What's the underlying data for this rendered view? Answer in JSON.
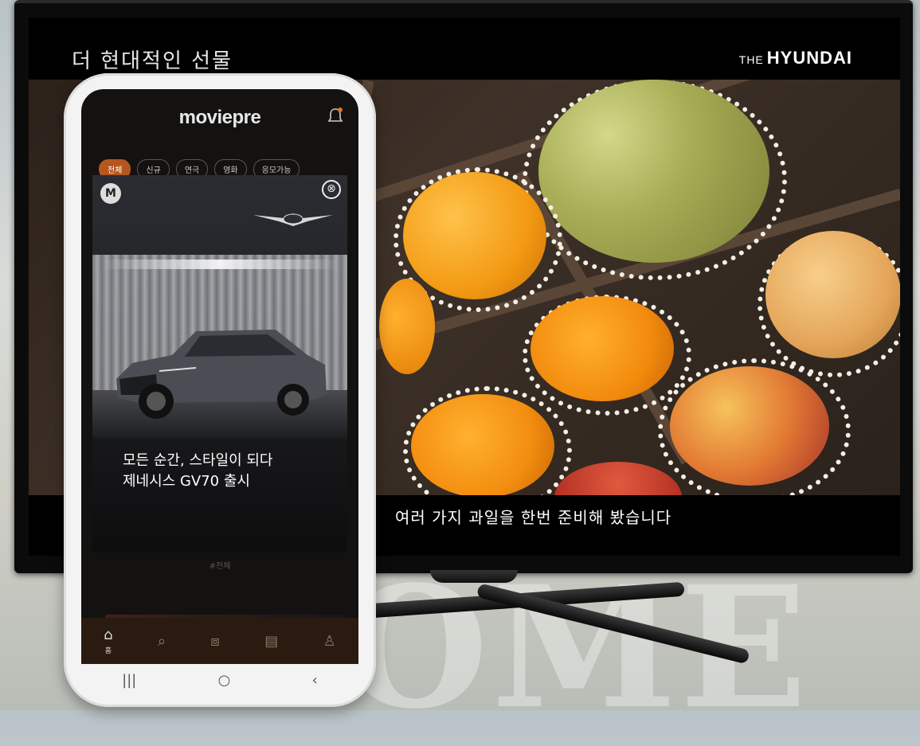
{
  "tv": {
    "title": "더 현대적인 선물",
    "brand_prefix": "THE",
    "brand_name": "HYUNDAI",
    "subtitle": "여러 가지 과일을 한번 준비해 봤습니다"
  },
  "phone": {
    "app_logo": "moviepre",
    "chips": [
      {
        "label": "전체",
        "active": true
      },
      {
        "label": "신규",
        "active": false
      },
      {
        "label": "연극",
        "active": false
      },
      {
        "label": "영화",
        "active": false
      },
      {
        "label": "응모가능",
        "active": false
      }
    ],
    "ad": {
      "badge": "M",
      "close": "⊗",
      "headline_1": "모든 순간, 스타일이 되다",
      "headline_2": "제네시스 GV70 출시"
    },
    "muted_text": "#전체",
    "tabs": [
      {
        "icon": "home-icon",
        "glyph": "⌂",
        "label": "홈",
        "active": true
      },
      {
        "icon": "search-icon",
        "glyph": "⌕",
        "label": "",
        "active": false
      },
      {
        "icon": "ticket-icon",
        "glyph": "⧈",
        "label": "",
        "active": false
      },
      {
        "icon": "document-icon",
        "glyph": "▤",
        "label": "",
        "active": false
      },
      {
        "icon": "profile-icon",
        "glyph": "♙",
        "label": "",
        "active": false
      }
    ],
    "system_nav": {
      "recent": "|||",
      "home": "○",
      "back": "‹"
    }
  },
  "colors": {
    "accent": "#b5561f",
    "tabbar": "#2a1a0f"
  }
}
